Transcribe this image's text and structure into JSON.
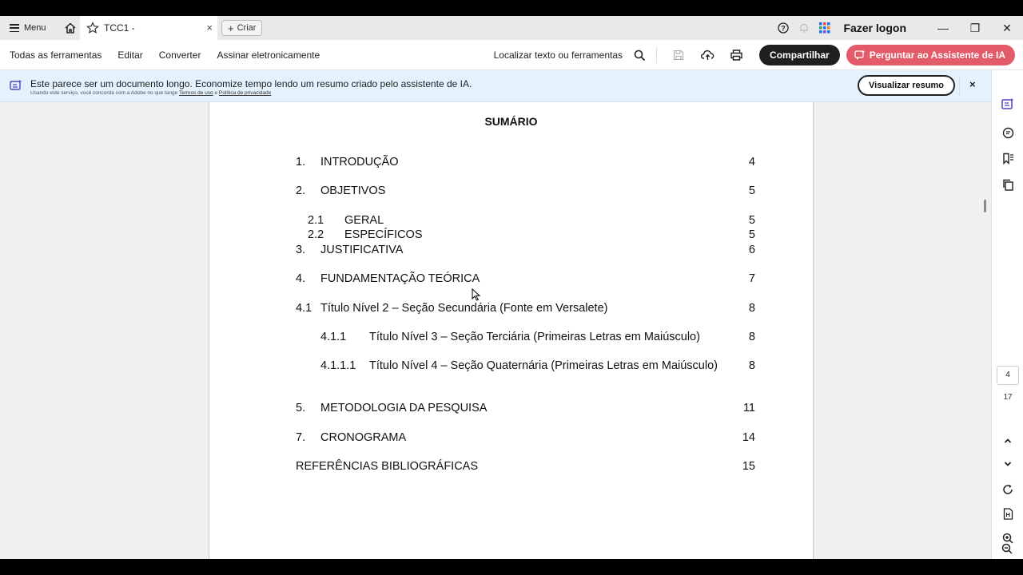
{
  "titlebar": {
    "menu_label": "Menu",
    "tab_title": "TCC1 -",
    "tab_close": "×",
    "create_label": "Criar",
    "logon_label": "Fazer logon",
    "minimize": "—",
    "restore": "❐",
    "close": "✕"
  },
  "toolbar": {
    "items": [
      "Todas as ferramentas",
      "Editar",
      "Converter",
      "Assinar eletronicamente"
    ],
    "search_label": "Localizar texto ou ferramentas",
    "share_label": "Compartilhar",
    "ai_label": "Perguntar ao Assistente de IA",
    "colors": {
      "share_bg": "#1f1f1f",
      "ai_bg": "#e35a68"
    }
  },
  "banner": {
    "message": "Este parece ser um documento longo. Economize tempo lendo um resumo criado pelo assistente de IA.",
    "sub_prefix": "Usando este serviço, você concorda com a Adobe no que tange",
    "terms_link": "Termos de uso",
    "sub_and": "e",
    "privacy_link": "Política de privacidade",
    "summary_button": "Visualizar resumo",
    "close": "×"
  },
  "document": {
    "heading": "SUMÁRIO",
    "toc": [
      {
        "num": "1.",
        "label": "INTRODUÇÃO",
        "page": "4"
      },
      {
        "num": "2.",
        "label": "OBJETIVOS",
        "page": "5"
      },
      {
        "num": "2.1",
        "label": "GERAL",
        "page": "5"
      },
      {
        "num": "2.2",
        "label": "ESPECÍFICOS",
        "page": "5"
      },
      {
        "num": "3.",
        "label": "JUSTIFICATIVA",
        "page": "6"
      },
      {
        "num": "4.",
        "label": "FUNDAMENTAÇÃO TEÓRICA",
        "page": "7"
      },
      {
        "num": "4.1",
        "label": "Título Nível 2 – Seção Secundária (Fonte em Versalete)",
        "page": "8"
      },
      {
        "num": "4.1.1",
        "label": "Título Nível 3 – Seção Terciária (Primeiras Letras em Maiúsculo)",
        "page": "8"
      },
      {
        "num": "4.1.1.1",
        "label": "Título Nível 4 – Seção Quaternária (Primeiras Letras em Maiúsculo)",
        "page": "8"
      },
      {
        "num": "5.",
        "label": "METODOLOGIA DA PESQUISA",
        "page": "11"
      },
      {
        "num": "7.",
        "label": "CRONOGRAMA",
        "page": "14"
      },
      {
        "num": "",
        "label": "REFERÊNCIAS BIBLIOGRÁFICAS",
        "page": "15"
      }
    ]
  },
  "sidebar": {
    "current_page": "4",
    "total_pages": "17",
    "icons": [
      "ai-summary-icon",
      "comment-icon",
      "bookmark-icon",
      "pages-icon",
      "chevron-up-icon",
      "chevron-down-icon",
      "refresh-icon",
      "page-fit-icon",
      "zoom-in-icon",
      "zoom-out-icon"
    ]
  }
}
